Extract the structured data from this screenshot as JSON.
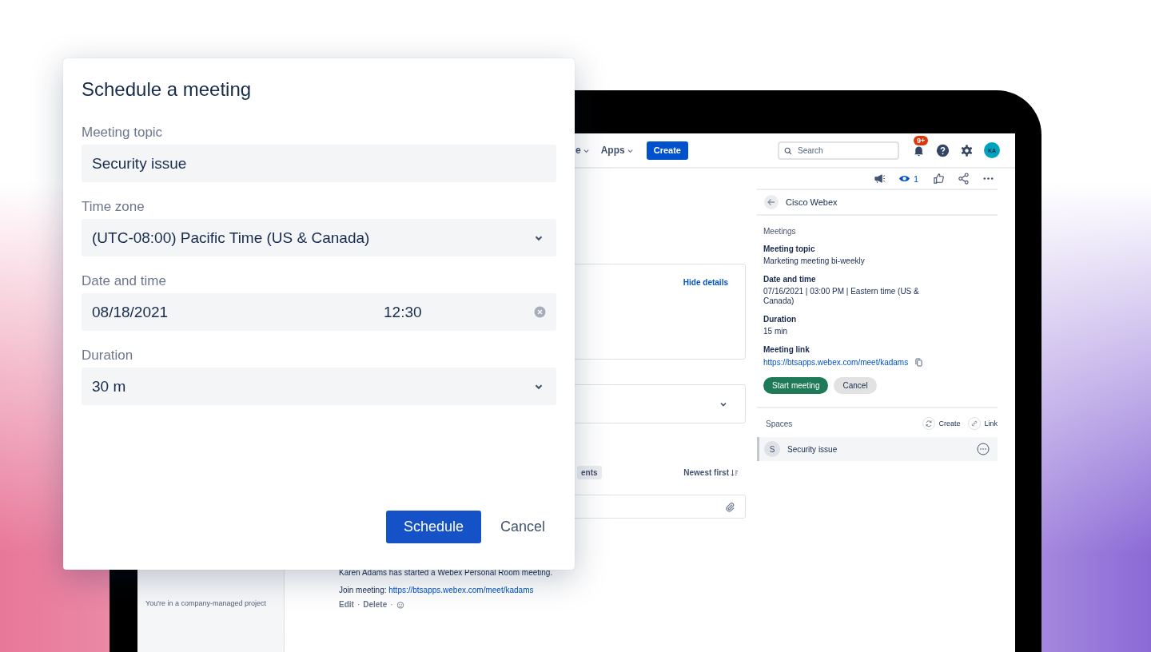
{
  "dialog": {
    "title": "Schedule a meeting",
    "fields": [
      {
        "label": "Meeting topic",
        "kind": "text",
        "value": "Security issue"
      },
      {
        "label": "Time zone",
        "kind": "select",
        "value": "(UTC-08:00) Pacific Time (US & Canada)"
      },
      {
        "label": "Date and time",
        "kind": "datetime",
        "date": "08/18/2021",
        "time": "12:30"
      },
      {
        "label": "Duration",
        "kind": "select",
        "value": "30 m"
      }
    ],
    "buttons": [
      {
        "label": "Schedule",
        "kind": "primary"
      },
      {
        "label": "Cancel",
        "kind": "plain"
      }
    ]
  },
  "topbar": {
    "nav_items": [
      {
        "label": "e"
      },
      {
        "label": "Apps"
      }
    ],
    "create_button": "Create",
    "search": {
      "placeholder": "Search"
    },
    "notification_badge": "9+",
    "avatar": "KA"
  },
  "issue_toolbar": {
    "watchers": "1"
  },
  "sidebar": {
    "footer": "You're in a company-managed project"
  },
  "center": {
    "details_link": "Hide details",
    "activity_tab": "ents",
    "sort": "Newest first",
    "comment": {
      "text": "Karen Adams has started a Webex Personal Room meeting.",
      "join_label": "Join meeting:",
      "join_link": "https://btsapps.webex.com/meet/kadams",
      "actions": [
        "Edit",
        "Delete"
      ],
      "separator": "·"
    }
  },
  "webex_panel": {
    "title": "Cisco Webex",
    "section": "Meetings",
    "details": [
      {
        "label": "Meeting topic",
        "kind": "text",
        "value": "Marketing meeting bi-weekly"
      },
      {
        "label": "Date and time",
        "kind": "text",
        "value": "07/16/2021 | 03:00 PM | Eastern time (US & Canada)"
      },
      {
        "label": "Duration",
        "kind": "text",
        "value": "15 min"
      },
      {
        "label": "Meeting link",
        "kind": "link",
        "value": "https://btsapps.webex.com/meet/kadams"
      }
    ],
    "buttons": [
      {
        "label": "Start meeting",
        "kind": "primary"
      },
      {
        "label": "Cancel",
        "kind": "secondary"
      }
    ],
    "spaces": {
      "title": "Spaces",
      "actions": [
        {
          "label": "Create",
          "kind": "create"
        },
        {
          "label": "Link",
          "kind": "link"
        }
      ],
      "items": [
        {
          "initial": "S",
          "name": "Security issue"
        }
      ]
    }
  }
}
